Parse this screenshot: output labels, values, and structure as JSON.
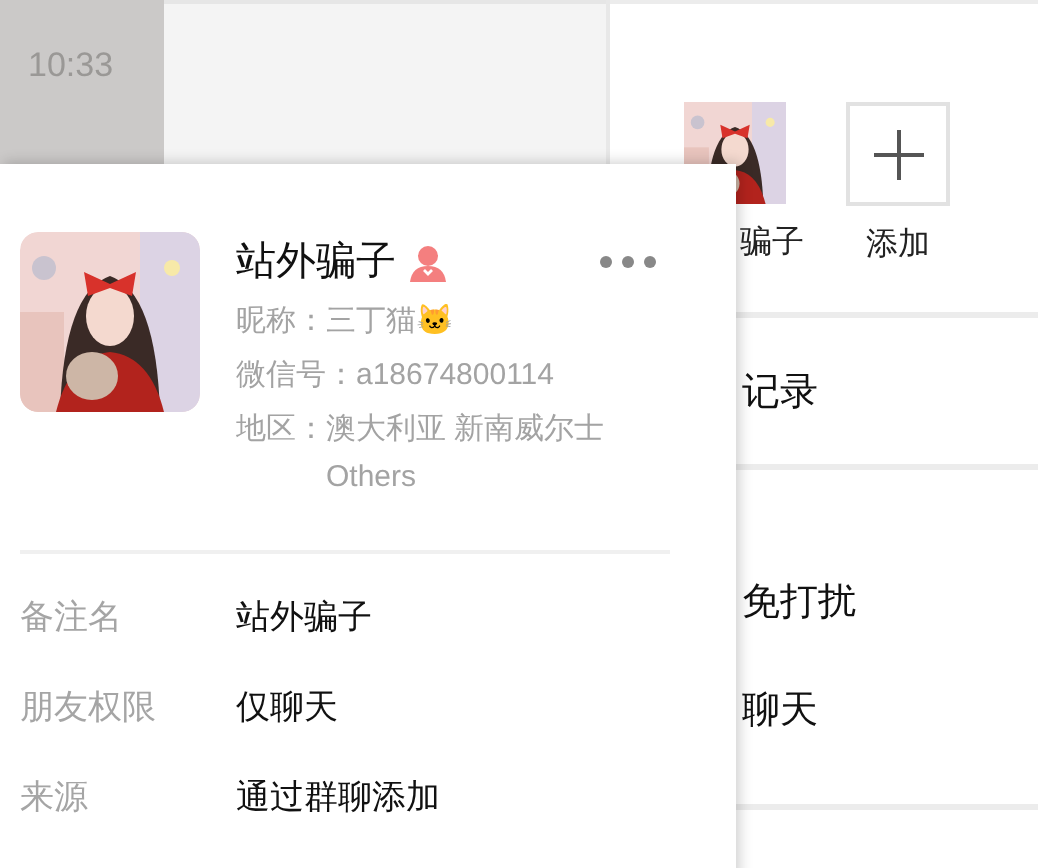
{
  "chat_list": {
    "time": "10:33"
  },
  "members": [
    {
      "kind": "avatar",
      "label": "骗子"
    },
    {
      "kind": "add",
      "label": "添加"
    }
  ],
  "settings": [
    [
      "记录"
    ],
    [
      "免打扰",
      "聊天"
    ]
  ],
  "profile_card": {
    "name": "站外骗子",
    "fields": [
      {
        "label": "昵称：",
        "value": "三丁猫🐱"
      },
      {
        "label": "微信号：",
        "value": "a18674800114"
      },
      {
        "label": "地区：",
        "value": "澳大利亚 新南威尔士 Others"
      }
    ],
    "details": [
      {
        "label": "备注名",
        "value": "站外骗子"
      },
      {
        "label": "朋友权限",
        "value": "仅聊天"
      },
      {
        "label": "来源",
        "value": "通过群聊添加"
      }
    ]
  }
}
